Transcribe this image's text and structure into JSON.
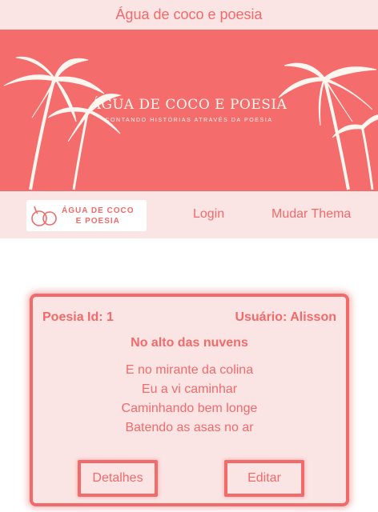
{
  "page": {
    "title": "Água de coco e poesia"
  },
  "banner": {
    "title": "ÁGUA DE COCO E POESIA",
    "subtitle": "CONTANDO HISTÓRIAS ATRAVÉS DA POESIA"
  },
  "navbar": {
    "logo_line1": "ÁGUA DE COCO",
    "logo_line2": "E POESIA",
    "login_label": "Login",
    "theme_label": "Mudar Thema"
  },
  "poem": {
    "id_label": "Poesia Id: 1",
    "user_label": "Usuário: Alisson",
    "title": "No alto das nuvens",
    "verses": [
      "E no mirante da colina",
      "Eu a vi caminhar",
      "Caminhando bem longe",
      "Batendo as asas no ar"
    ],
    "details_label": "Detalhes",
    "edit_label": "Editar"
  },
  "colors": {
    "accent": "#f26a6a",
    "banner": "#f56c6c",
    "background_light": "#fbe4e4"
  },
  "icons": [
    "palm-tree-icon",
    "coconut-icon"
  ]
}
